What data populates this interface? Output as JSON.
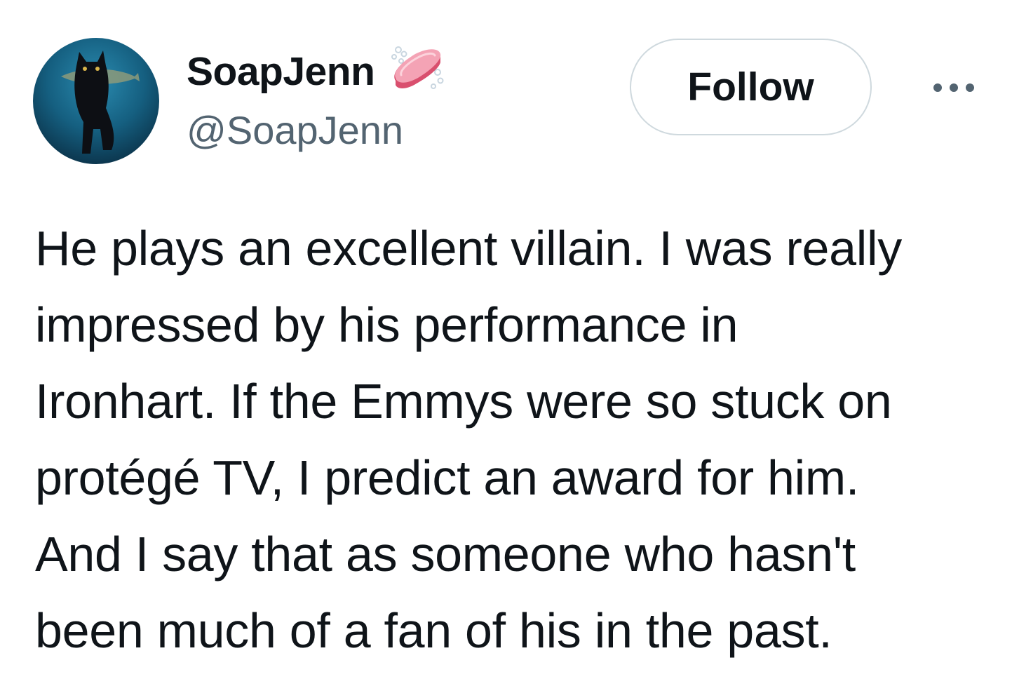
{
  "tweet": {
    "author": {
      "display_name": "SoapJenn",
      "handle": "@SoapJenn",
      "name_emoji": "soap-emoji",
      "avatar": "avatar-black-cat-underwater"
    },
    "follow_label": "Follow",
    "more_icon": "more-icon",
    "text_lines": [
      "He plays an excellent villain. I was really",
      "impressed by his performance in",
      "Ironhart. If the Emmys were so stuck on",
      "protégé TV, I predict an award for him.",
      "And I say that as someone who hasn't",
      "been much of a fan of his in the past."
    ]
  },
  "colors": {
    "text_primary": "#0f1419",
    "text_secondary": "#536471",
    "button_border": "#cfd9de",
    "background": "#ffffff",
    "soap_pink": "#f27a93"
  }
}
